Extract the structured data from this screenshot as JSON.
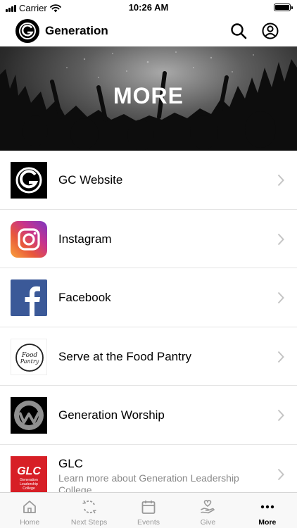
{
  "status_bar": {
    "carrier": "Carrier",
    "time": "10:26 AM"
  },
  "header": {
    "title": "Generation"
  },
  "hero": {
    "title": "MORE"
  },
  "menu": [
    {
      "label": "GC Website",
      "icon": "generation-logo-icon"
    },
    {
      "label": "Instagram",
      "icon": "instagram-icon"
    },
    {
      "label": "Facebook",
      "icon": "facebook-icon"
    },
    {
      "label": "Serve at the Food Pantry",
      "icon": "food-pantry-logo-icon",
      "logo_text": "Food Pantry"
    },
    {
      "label": "Generation Worship",
      "icon": "generation-worship-logo-icon"
    },
    {
      "label": "GLC",
      "subtitle": "Learn more about Generation Leadership College",
      "icon": "glc-logo-icon",
      "logo_text": "GLC",
      "logo_subtext": "Generation Leadership College"
    }
  ],
  "tabs": [
    {
      "label": "Home",
      "icon": "home-icon"
    },
    {
      "label": "Next Steps",
      "icon": "next-steps-icon"
    },
    {
      "label": "Events",
      "icon": "calendar-icon"
    },
    {
      "label": "Give",
      "icon": "give-hand-heart-icon"
    },
    {
      "label": "More",
      "icon": "more-dots-icon",
      "active": true
    }
  ],
  "colors": {
    "facebook": "#3b5998",
    "glc_red": "#d71f26",
    "active_tab": "#000000",
    "inactive_tab": "#999999"
  }
}
